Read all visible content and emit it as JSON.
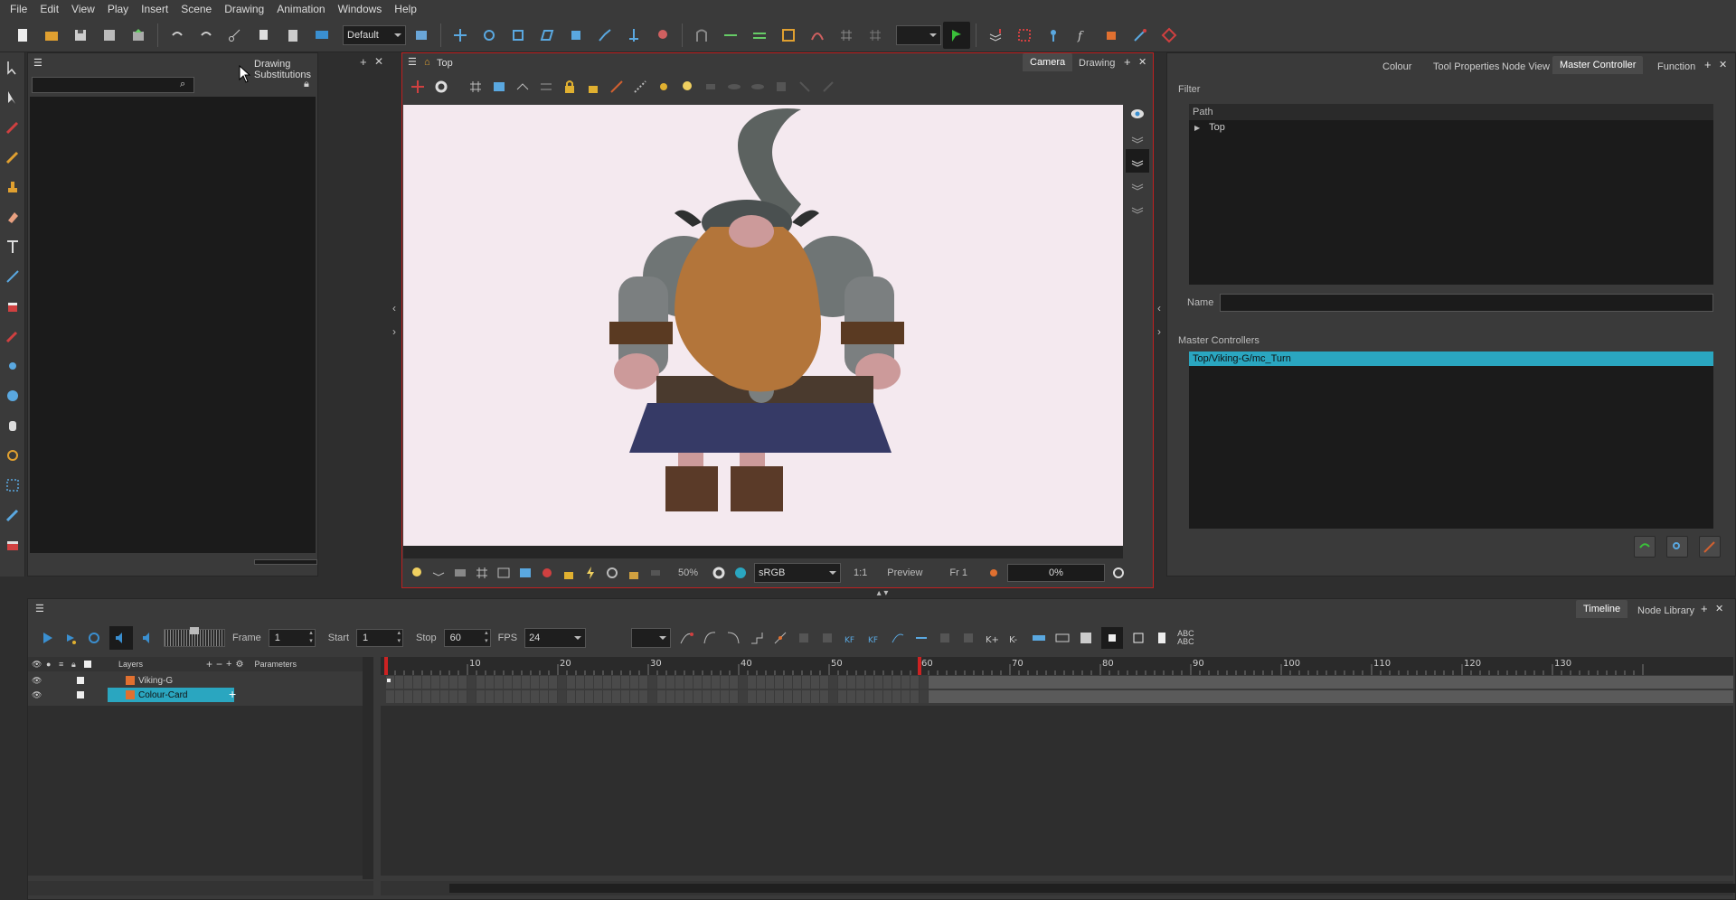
{
  "menu": [
    "File",
    "Edit",
    "View",
    "Play",
    "Insert",
    "Scene",
    "Drawing",
    "Animation",
    "Windows",
    "Help"
  ],
  "toolbar": {
    "workspace": "Default"
  },
  "left_panel": {
    "title": "Drawing Substitutions",
    "search_placeholder": ""
  },
  "camera_panel": {
    "breadcrumb": "Top",
    "tabs": [
      "Camera",
      "Drawing"
    ],
    "status": {
      "zoom": "50%",
      "color_space": "sRGB",
      "ratio": "1:1",
      "preview": "Preview",
      "frame": "Fr 1",
      "progress": "0%",
      "progress_value": 0
    }
  },
  "right_panel": {
    "tabs": [
      "Colour",
      "Tool Properties",
      "Node View",
      "Master Controller",
      "Function"
    ],
    "active_tab": "Master Controller",
    "filter_label": "Filter",
    "path_header": "Path",
    "tree_item": "Top",
    "name_label": "Name",
    "name_value": "",
    "controllers_label": "Master Controllers",
    "controllers": [
      "Top/Viking-G/mc_Turn"
    ]
  },
  "timeline": {
    "tabs": [
      "Timeline",
      "Node Library"
    ],
    "frame_label": "Frame",
    "frame": "1",
    "start_label": "Start",
    "start": "1",
    "stop_label": "Stop",
    "stop": "60",
    "fps_label": "FPS",
    "fps": "24",
    "layers_header": "Layers",
    "params_header": "Parameters",
    "layers": [
      {
        "name": "Viking-G",
        "selected": false
      },
      {
        "name": "Colour-Card",
        "selected": true
      }
    ],
    "ruler": [
      "10",
      "20",
      "30",
      "40",
      "50",
      "60",
      "70",
      "80",
      "90",
      "100",
      "110",
      "120",
      "130"
    ],
    "abc": "ABC ABC"
  },
  "colors": {
    "accent": "#2aa6c0",
    "viewport_bg": "#f4e9ef",
    "panel": "#3a3a3a",
    "dark": "#1b1b1b",
    "selection": "#2aa6c0",
    "frame_marker": "#cc2222"
  }
}
